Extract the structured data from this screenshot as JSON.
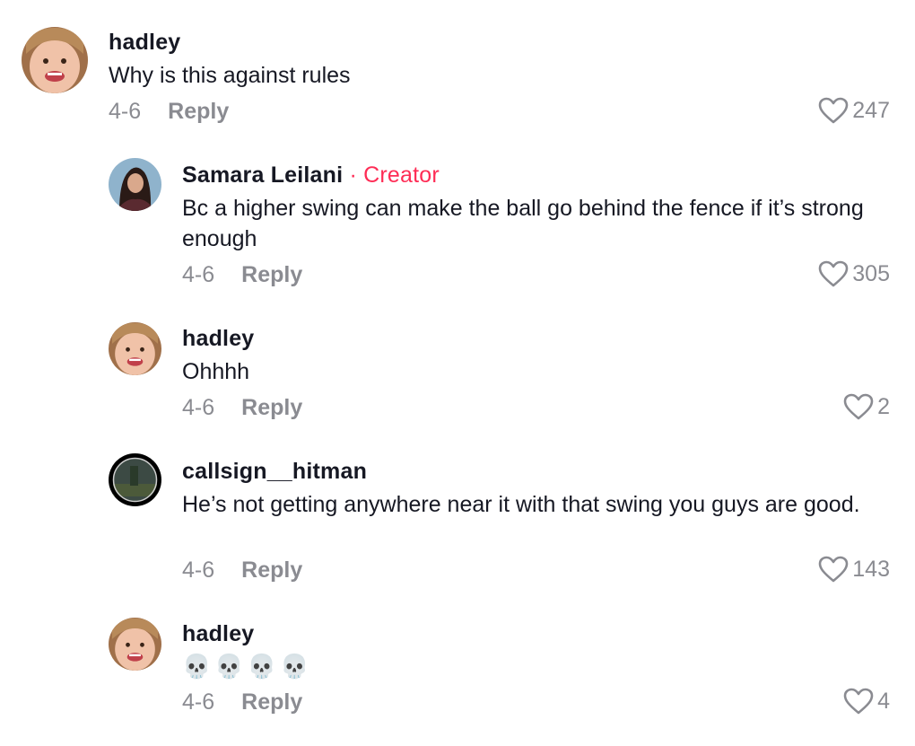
{
  "comments": [
    {
      "username": "hadley",
      "text": "Why is this against rules",
      "date": "4-6",
      "reply_label": "Reply",
      "likes": "247",
      "avatar": "child-avatar"
    },
    {
      "username": "Samara Leilani",
      "creator_label": "Creator",
      "text": "Bc a higher swing can make the ball go behind the fence if it’s strong enough",
      "date": "4-6",
      "reply_label": "Reply",
      "likes": "305",
      "avatar": "woman-avatar"
    },
    {
      "username": "hadley",
      "text": "Ohhhh",
      "date": "4-6",
      "reply_label": "Reply",
      "likes": "2",
      "avatar": "child-avatar"
    },
    {
      "username": "callsign__hitman",
      "text": "He’s not getting anywhere near it with that swing you guys are good.",
      "date": "4-6",
      "reply_label": "Reply",
      "likes": "143",
      "avatar": "scope-avatar"
    },
    {
      "username": "hadley",
      "text": "💀💀💀💀",
      "date": "4-6",
      "reply_label": "Reply",
      "likes": "4",
      "avatar": "child-avatar"
    }
  ],
  "colors": {
    "creator": "#fe2c55",
    "meta": "#8a8b91",
    "text": "#161823"
  },
  "icons": {
    "like": "heart-outline-icon"
  }
}
